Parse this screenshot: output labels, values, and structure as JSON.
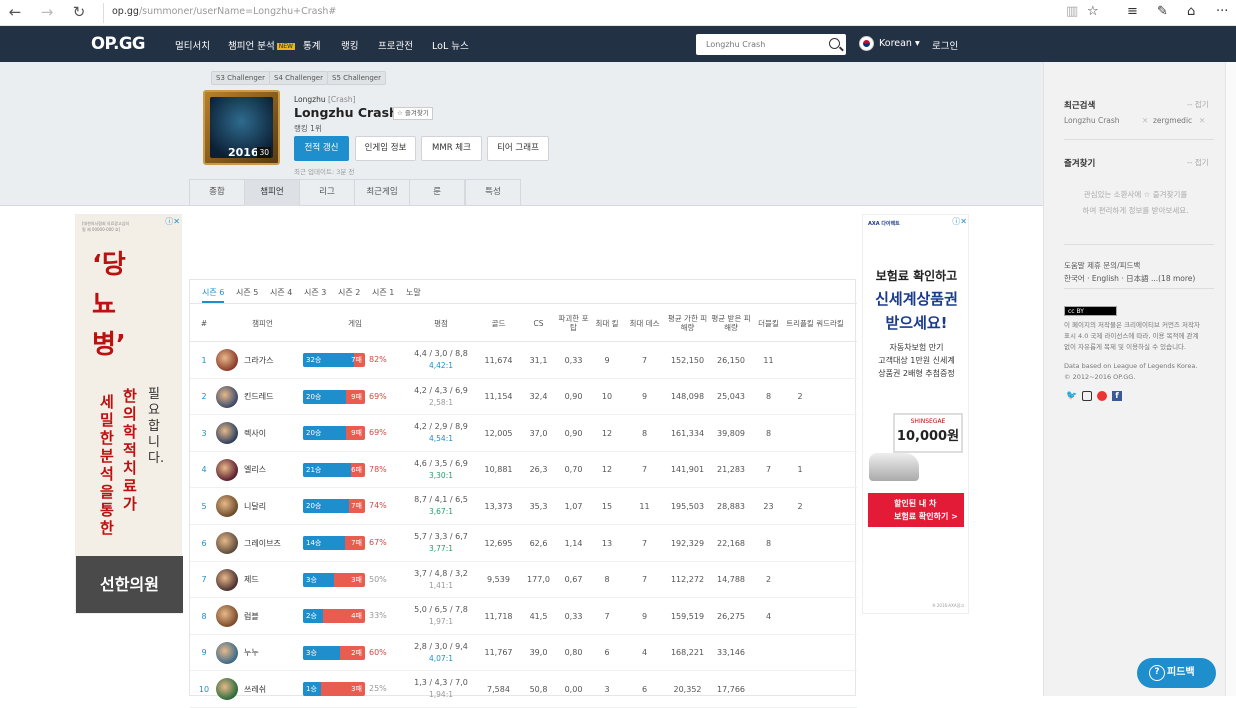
{
  "browser": {
    "url": "op.gg",
    "url_path": "/summoner/userName=Longzhu+Crash#"
  },
  "nav": {
    "logo": "OP.GG",
    "items": [
      "멀티서치",
      "챔피언 분석",
      "통계",
      "랭킹",
      "프로관전",
      "LoL 뉴스"
    ],
    "hot_badge": "NEW",
    "search_value": "Longzhu Crash",
    "language": "Korean ▾",
    "login": "로그인"
  },
  "profile": {
    "season_tags": [
      "S3 Challenger",
      "S4 Challenger",
      "S5 Challenger"
    ],
    "year": "2016",
    "level": "30",
    "team": "Longzhu",
    "team_tag": "[Crash]",
    "name": "Longzhu Crash",
    "fav_label": "☆ 즐겨찾기",
    "ladder_rank": "랭킹 1위",
    "buttons": [
      "전적 갱신",
      "인게임 정보",
      "MMR 체크",
      "티어 그래프"
    ],
    "updated": "최근 업데이트: 3분 전",
    "tabs": [
      "종합",
      "챔피언",
      "리그",
      "최근게임",
      "룬",
      "특성"
    ]
  },
  "left_ad": {
    "small_text": "[대한의사협회 의료광고심의필 제 00000-000 호]",
    "quote": "‘당뇨병’",
    "col_a": "필요합니다.",
    "col_b": "한의학적 치료가",
    "col_c": "세밀한 분석을 통한",
    "footer": "선한의원"
  },
  "right_ad": {
    "brand": "AXA 다이렉트",
    "line1": "보험료 확인하고",
    "line2": "신세계상품권",
    "line3": "받으세요!",
    "desc1": "자동차보험 만기",
    "desc2": "고객대상 1만원 신세계",
    "desc3": "상품권 2배형 추첨증정",
    "voucher_brand": "SHINSEGAE",
    "voucher_value": "10,000원",
    "cta1": "할인된 내 차",
    "cta2": "보험료 확인하기 >",
    "footnote": "※ 2016-AXA광고"
  },
  "season_tabs": [
    "시즌 6",
    "시즌 5",
    "시즌 4",
    "시즌 3",
    "시즌 2",
    "시즌 1",
    "노말"
  ],
  "columns": [
    "#",
    "챔피언",
    "게임",
    "평점",
    "골드",
    "CS",
    "파괴한 포탑",
    "최대 킬",
    "최대 데스",
    "평균 가한 피해량",
    "평균 받은 피해량",
    "더블킬",
    "트리플킬",
    "쿼드라킬"
  ],
  "rows": [
    {
      "rank": "1",
      "champ": "그라가스",
      "color": "#8a3b2a",
      "wins": "32승",
      "losses": "7패",
      "winfrac": 0.82,
      "pct": "82%",
      "kda": "4,4 / 3,0 / 8,8",
      "ratio": "4,42:1",
      "gold": "11,674",
      "cs": "31,1",
      "towers": "0,33",
      "maxkill": "9",
      "maxdeath": "7",
      "dealt": "152,150",
      "taken": "26,150",
      "double": "11",
      "triple": "",
      "quadra": ""
    },
    {
      "rank": "2",
      "champ": "킨드레드",
      "color": "#3a4a6b",
      "wins": "20승",
      "losses": "9패",
      "winfrac": 0.69,
      "pct": "69%",
      "kda": "4,2 / 4,3 / 6,9",
      "ratio": "2,58:1",
      "gold": "11,154",
      "cs": "32,4",
      "towers": "0,90",
      "maxkill": "10",
      "maxdeath": "9",
      "dealt": "148,098",
      "taken": "25,043",
      "double": "8",
      "triple": "2",
      "quadra": ""
    },
    {
      "rank": "3",
      "champ": "렉사이",
      "color": "#2b3f5e",
      "wins": "20승",
      "losses": "9패",
      "winfrac": 0.69,
      "pct": "69%",
      "kda": "4,2 / 2,9 / 8,9",
      "ratio": "4,54:1",
      "gold": "12,005",
      "cs": "37,0",
      "towers": "0,90",
      "maxkill": "12",
      "maxdeath": "8",
      "dealt": "161,334",
      "taken": "39,809",
      "double": "8",
      "triple": "",
      "quadra": ""
    },
    {
      "rank": "4",
      "champ": "엘리스",
      "color": "#5a1e2e",
      "wins": "21승",
      "losses": "6패",
      "winfrac": 0.78,
      "pct": "78%",
      "kda": "4,6 / 3,5 / 6,9",
      "ratio": "3,30:1",
      "gold": "10,881",
      "cs": "26,3",
      "towers": "0,70",
      "maxkill": "12",
      "maxdeath": "7",
      "dealt": "141,901",
      "taken": "21,283",
      "double": "7",
      "triple": "1",
      "quadra": ""
    },
    {
      "rank": "5",
      "champ": "니달리",
      "color": "#6b4a2a",
      "wins": "20승",
      "losses": "7패",
      "winfrac": 0.74,
      "pct": "74%",
      "kda": "8,7 / 4,1 / 6,5",
      "ratio": "3,67:1",
      "gold": "13,373",
      "cs": "35,3",
      "towers": "1,07",
      "maxkill": "15",
      "maxdeath": "11",
      "dealt": "195,503",
      "taken": "28,883",
      "double": "23",
      "triple": "2",
      "quadra": ""
    },
    {
      "rank": "6",
      "champ": "그레이브즈",
      "color": "#5c4a3a",
      "wins": "14승",
      "losses": "7패",
      "winfrac": 0.67,
      "pct": "67%",
      "kda": "5,7 / 3,3 / 6,7",
      "ratio": "3,77:1",
      "gold": "12,695",
      "cs": "62,6",
      "towers": "1,14",
      "maxkill": "13",
      "maxdeath": "7",
      "dealt": "192,329",
      "taken": "22,168",
      "double": "8",
      "triple": "",
      "quadra": ""
    },
    {
      "rank": "7",
      "champ": "제드",
      "color": "#4a3030",
      "wins": "3승",
      "losses": "3패",
      "winfrac": 0.5,
      "pct": "50%",
      "kda": "3,7 / 4,8 / 3,2",
      "ratio": "1,41:1",
      "gold": "9,539",
      "cs": "177,0",
      "towers": "0,67",
      "maxkill": "8",
      "maxdeath": "7",
      "dealt": "112,272",
      "taken": "14,788",
      "double": "2",
      "triple": "",
      "quadra": ""
    },
    {
      "rank": "8",
      "champ": "럼블",
      "color": "#7a4a2a",
      "wins": "2승",
      "losses": "4패",
      "winfrac": 0.33,
      "pct": "33%",
      "kda": "5,0 / 6,5 / 7,8",
      "ratio": "1,97:1",
      "gold": "11,718",
      "cs": "41,5",
      "towers": "0,33",
      "maxkill": "7",
      "maxdeath": "9",
      "dealt": "159,519",
      "taken": "26,275",
      "double": "4",
      "triple": "",
      "quadra": ""
    },
    {
      "rank": "9",
      "champ": "누누",
      "color": "#3a6a8a",
      "wins": "3승",
      "losses": "2패",
      "winfrac": 0.6,
      "pct": "60%",
      "kda": "2,8 / 3,0 / 9,4",
      "ratio": "4,07:1",
      "gold": "11,767",
      "cs": "39,0",
      "towers": "0,80",
      "maxkill": "6",
      "maxdeath": "4",
      "dealt": "168,221",
      "taken": "33,146",
      "double": "",
      "triple": "",
      "quadra": ""
    },
    {
      "rank": "10",
      "champ": "쓰레쉬",
      "color": "#2a6a3a",
      "wins": "1승",
      "losses": "3패",
      "winfrac": 0.25,
      "pct": "25%",
      "kda": "1,3 / 4,3 / 7,0",
      "ratio": "1,94:1",
      "gold": "7,584",
      "cs": "50,8",
      "towers": "0,00",
      "maxkill": "3",
      "maxdeath": "6",
      "dealt": "20,352",
      "taken": "17,766",
      "double": "",
      "triple": "",
      "quadra": ""
    }
  ],
  "side": {
    "recent_title": "최근검색",
    "recent_close": "-- 접기",
    "recent_items": [
      "Longzhu Crash",
      "zergmedic"
    ],
    "fav_title": "즐겨찾기",
    "fav_close": "-- 접기",
    "fav_desc1": "관심있는 소환사에 ☆ 즐겨찾기를",
    "fav_desc2": "하여 편리하게 정보를 받아보세요.",
    "links": "도움말 제휴 문의/피드백",
    "langs": "한국어 · English · 日本語 ...(18 more)",
    "cc": "cc BY",
    "license1": "이 페이지의 저작물은 크리에이티브 커먼즈 저작자",
    "license2": "표시 4.0 국제 라이선스에 따라, 이용 목적에 관계",
    "license3": "없이 자유롭게 복제 및 이용하실 수 있습니다.",
    "data1": "Data based on League of Legends Korea.",
    "data2": "© 2012~2016 OP.GG."
  },
  "feedback": "피드백"
}
